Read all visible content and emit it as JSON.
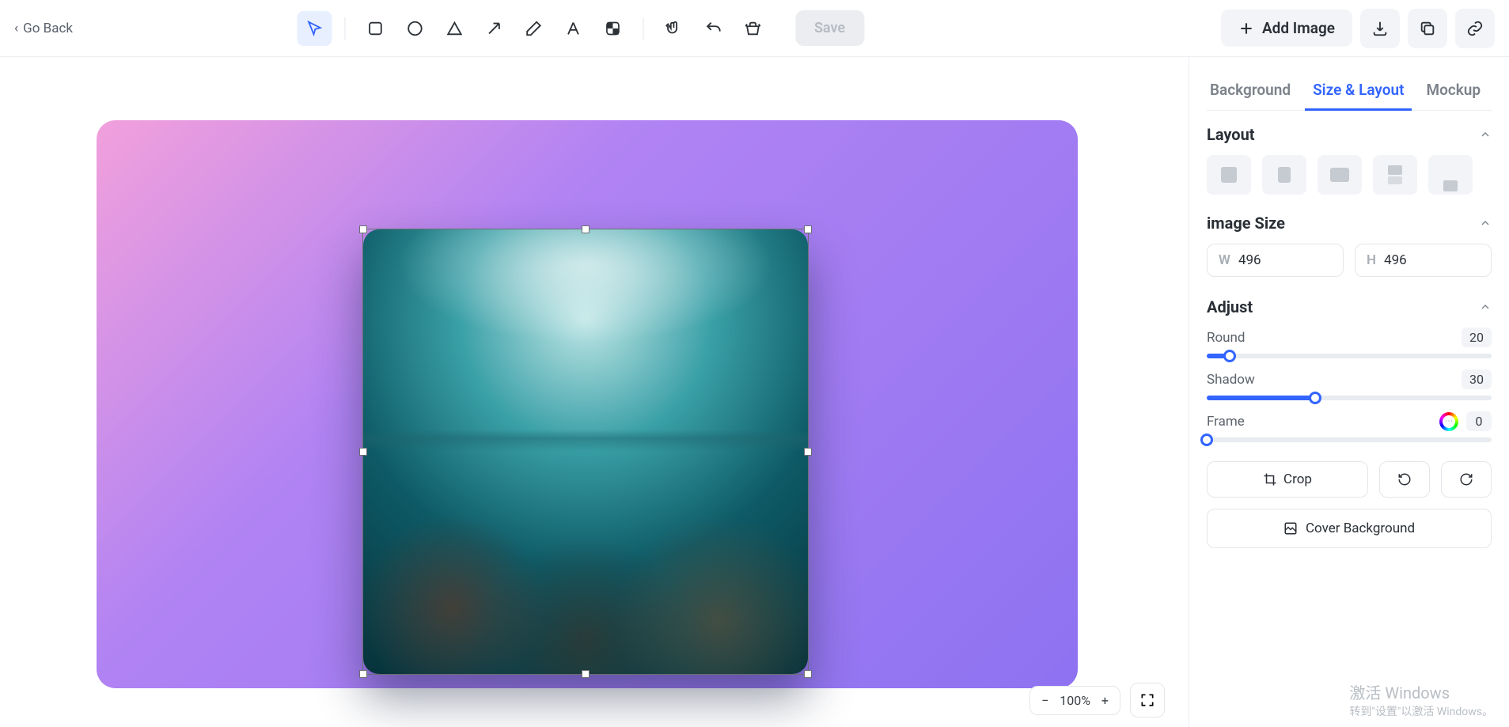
{
  "header": {
    "go_back": "Go Back",
    "save": "Save",
    "add_image": "Add Image"
  },
  "zoom": {
    "level": "100%"
  },
  "tabs": {
    "background": "Background",
    "size_layout": "Size & Layout",
    "mockup": "Mockup"
  },
  "sections": {
    "layout": "Layout",
    "image_size": "image Size",
    "adjust": "Adjust"
  },
  "image_size": {
    "w_label": "W",
    "w": "496",
    "h_label": "H",
    "h": "496"
  },
  "adjust": {
    "round_label": "Round",
    "round_value": "20",
    "round_pct": 8,
    "shadow_label": "Shadow",
    "shadow_value": "30",
    "shadow_pct": 38,
    "frame_label": "Frame",
    "frame_value": "0",
    "frame_pct": 0
  },
  "buttons": {
    "crop": "Crop",
    "cover_bg": "Cover Background"
  },
  "watermark": {
    "line1": "激活 Windows",
    "line2": "转到\"设置\"以激活 Windows。"
  }
}
